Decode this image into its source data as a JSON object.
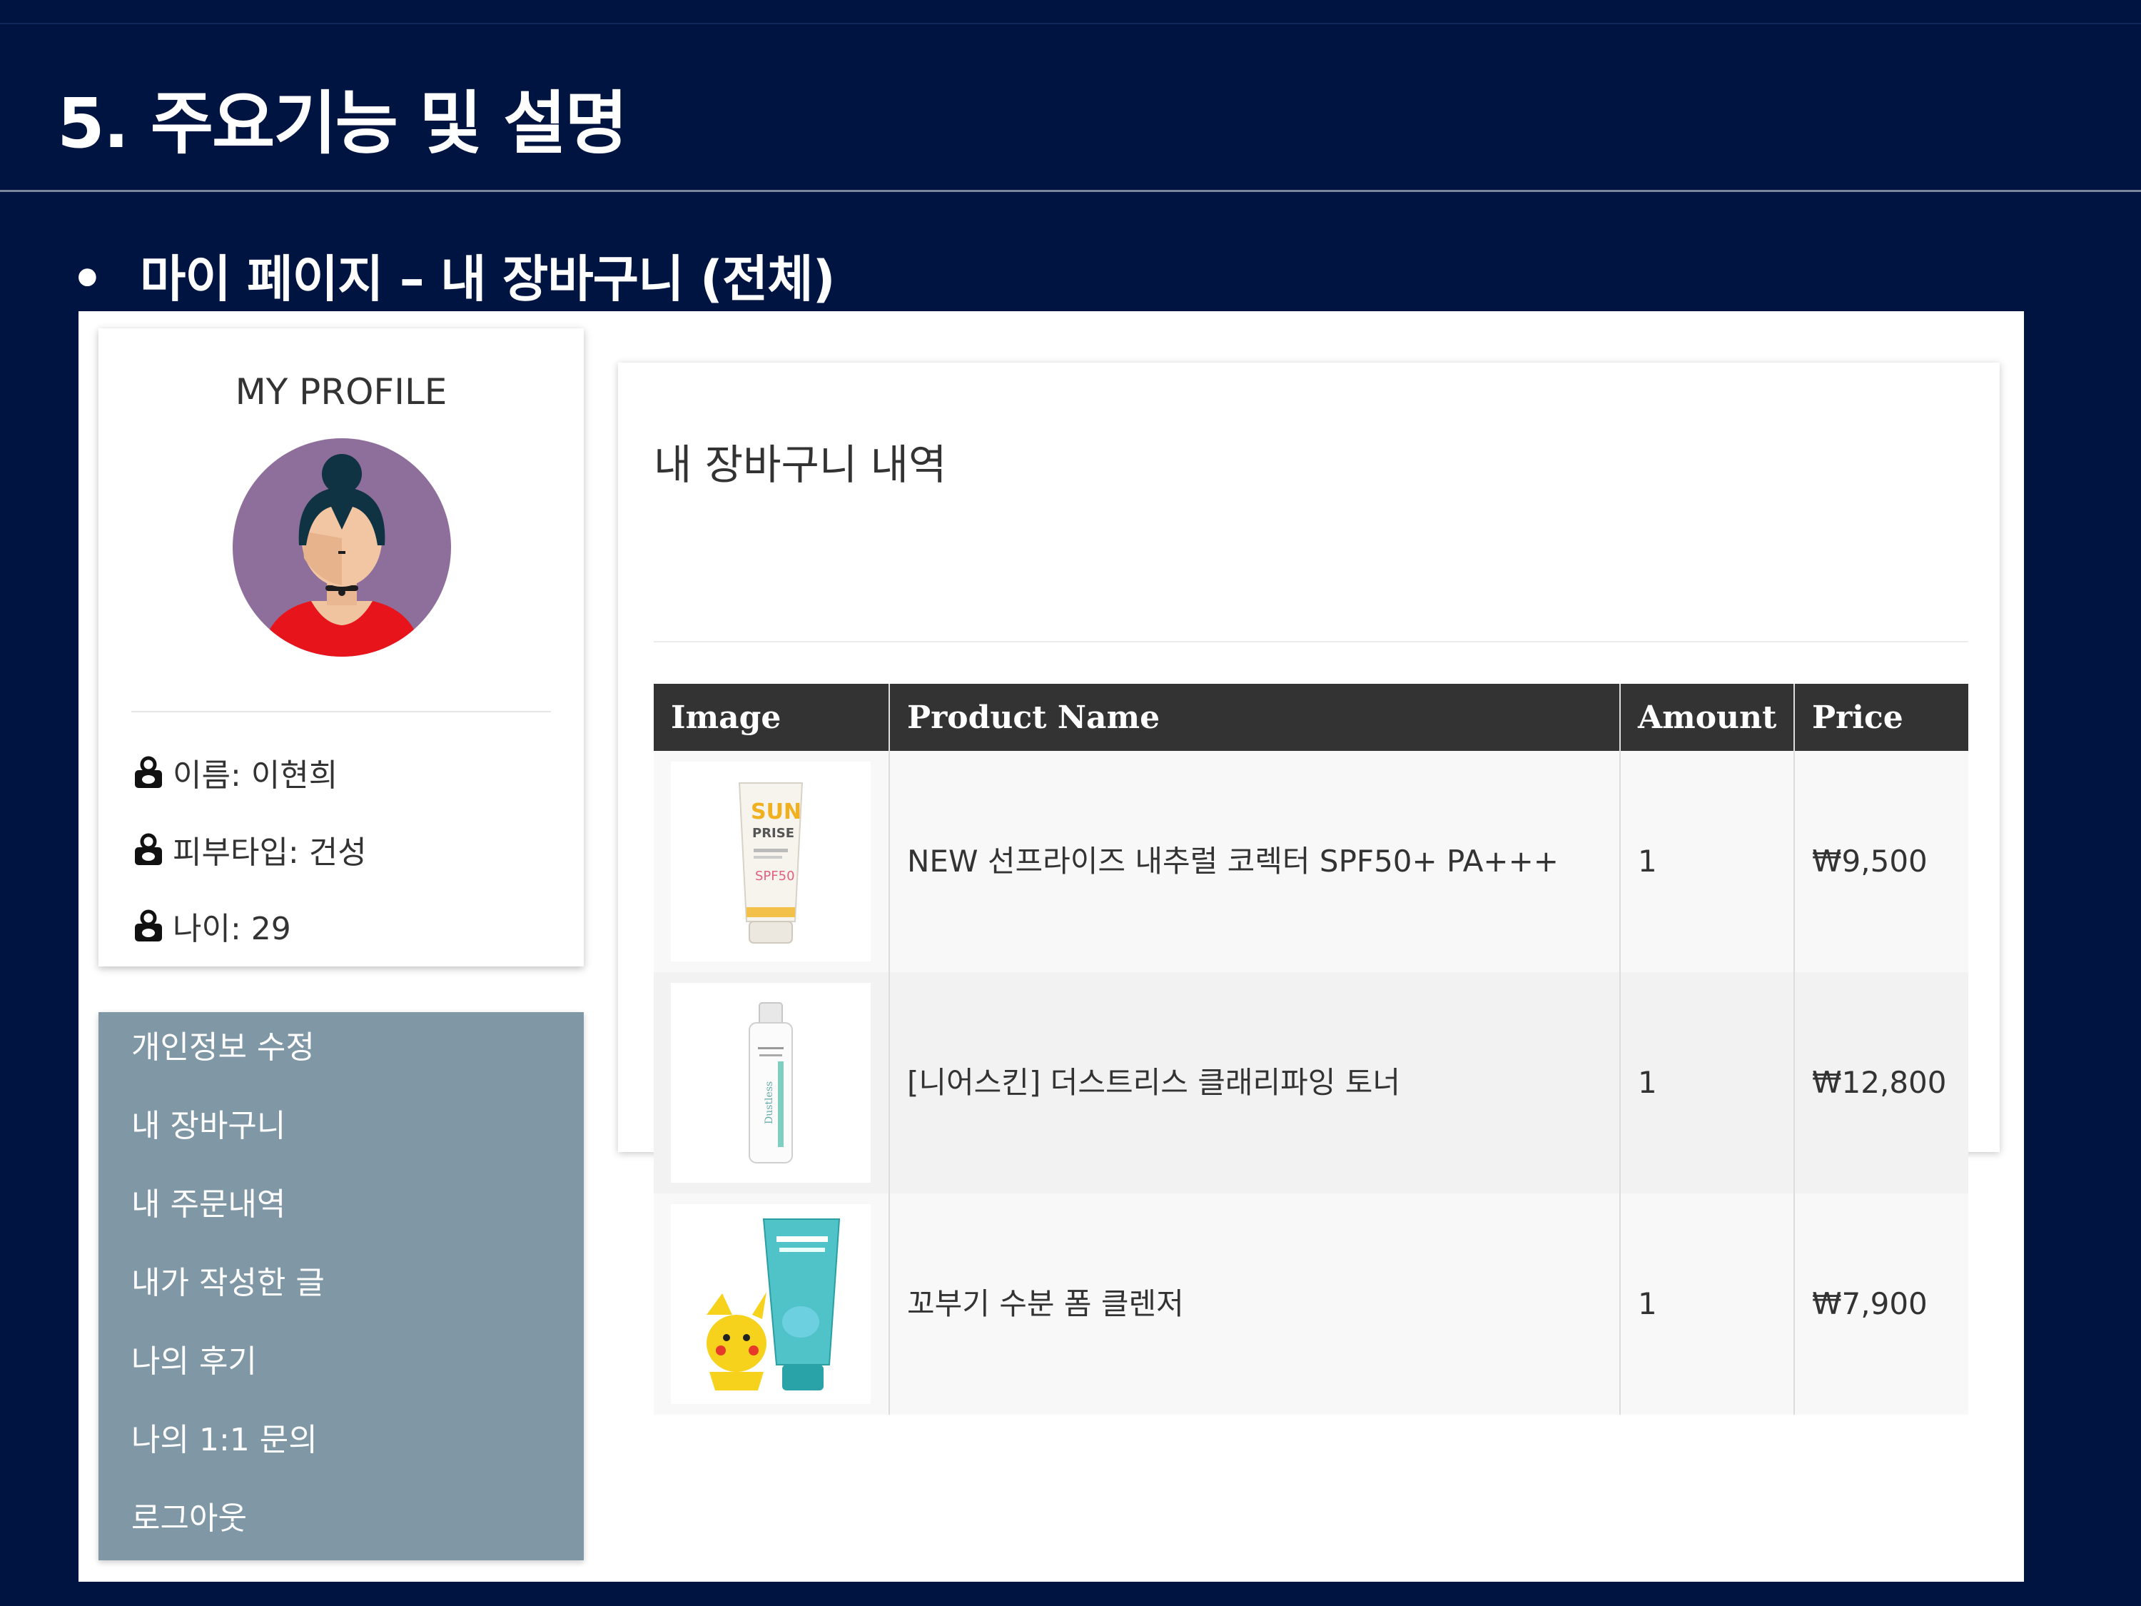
{
  "slide": {
    "title": "5. 주요기능 및 설명",
    "subtitle_bullet": "•",
    "subtitle": "마이 페이지 – 내 장바구니 (전체)"
  },
  "profile": {
    "title": "MY PROFILE",
    "rows": [
      {
        "label": "이름: 이현희",
        "icon": "user-lock-icon"
      },
      {
        "label": "피부타입: 건성",
        "icon": "user-lock-icon"
      },
      {
        "label": "나이: 29",
        "icon": "user-lock-icon"
      }
    ]
  },
  "menu": {
    "items": [
      "개인정보 수정",
      "내 장바구니",
      "내 주문내역",
      "내가 작성한 글",
      "나의 후기",
      "나의 1:1 문의",
      "로그아웃"
    ]
  },
  "cart": {
    "title": "내 장바구니 내역",
    "headers": {
      "image": "Image",
      "name": "Product Name",
      "amount": "Amount",
      "price": "Price"
    },
    "rows": [
      {
        "image": "sunscreen-tube-image",
        "name": "NEW 선프라이즈 내추럴 코렉터 SPF50+ PA+++",
        "amount": "1",
        "price": "₩9,500"
      },
      {
        "image": "toner-bottle-image",
        "name": "[니어스킨] 더스트리스 클래리파잉 토너",
        "amount": "1",
        "price": "₩12,800"
      },
      {
        "image": "foam-cleanser-pikachu-image",
        "name": "꼬부기 수분 폼 클렌저",
        "amount": "1",
        "price": "₩7,900"
      }
    ]
  },
  "colors": {
    "slide_bg": "#001442",
    "menu_bg": "#8098a6",
    "table_header_bg": "#333333",
    "avatar_bg": "#8e6f9c"
  }
}
